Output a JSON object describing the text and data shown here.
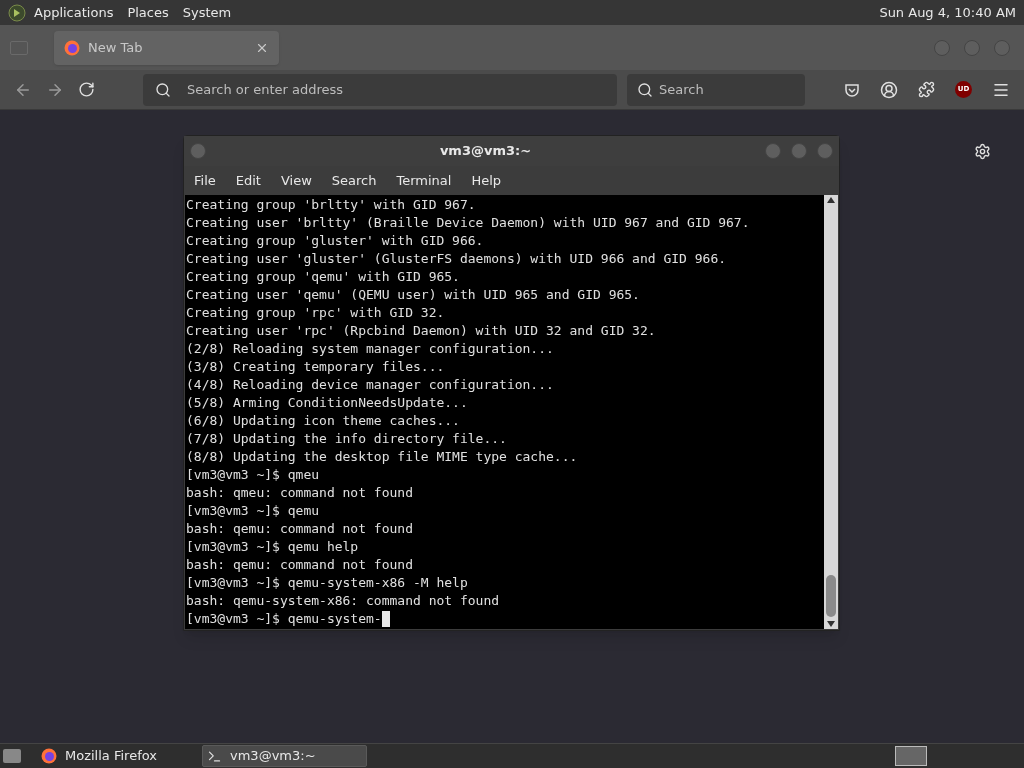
{
  "top_panel": {
    "menus": [
      "Applications",
      "Places",
      "System"
    ],
    "clock": "Sun Aug  4, 10:40 AM"
  },
  "browser": {
    "tabs": [
      {
        "label": "New Tab",
        "selected": true
      }
    ],
    "address": {
      "placeholder": "Search or enter address"
    },
    "search": {
      "placeholder": "Search"
    },
    "extension_badge": "UD"
  },
  "terminal": {
    "title": "vm3@vm3:~",
    "menus": [
      "File",
      "Edit",
      "View",
      "Search",
      "Terminal",
      "Help"
    ],
    "lines": [
      "Creating group 'brltty' with GID 967.",
      "Creating user 'brltty' (Braille Device Daemon) with UID 967 and GID 967.",
      "Creating group 'gluster' with GID 966.",
      "Creating user 'gluster' (GlusterFS daemons) with UID 966 and GID 966.",
      "Creating group 'qemu' with GID 965.",
      "Creating user 'qemu' (QEMU user) with UID 965 and GID 965.",
      "Creating group 'rpc' with GID 32.",
      "Creating user 'rpc' (Rpcbind Daemon) with UID 32 and GID 32.",
      "(2/8) Reloading system manager configuration...",
      "(3/8) Creating temporary files...",
      "(4/8) Reloading device manager configuration...",
      "(5/8) Arming ConditionNeedsUpdate...",
      "(6/8) Updating icon theme caches...",
      "(7/8) Updating the info directory file...",
      "(8/8) Updating the desktop file MIME type cache...",
      "[vm3@vm3 ~]$ qmeu",
      "bash: qmeu: command not found",
      "[vm3@vm3 ~]$ qemu",
      "bash: qemu: command not found",
      "[vm3@vm3 ~]$ qemu help",
      "bash: qemu: command not found",
      "[vm3@vm3 ~]$ qemu-system-x86 -M help",
      "bash: qemu-system-x86: command not found"
    ],
    "prompt": "[vm3@vm3 ~]$ qemu-system-"
  },
  "taskbar": {
    "items": [
      {
        "label": "Mozilla Firefox",
        "kind": "firefox",
        "selected": false
      },
      {
        "label": "vm3@vm3:~",
        "kind": "terminal",
        "selected": true
      }
    ]
  }
}
